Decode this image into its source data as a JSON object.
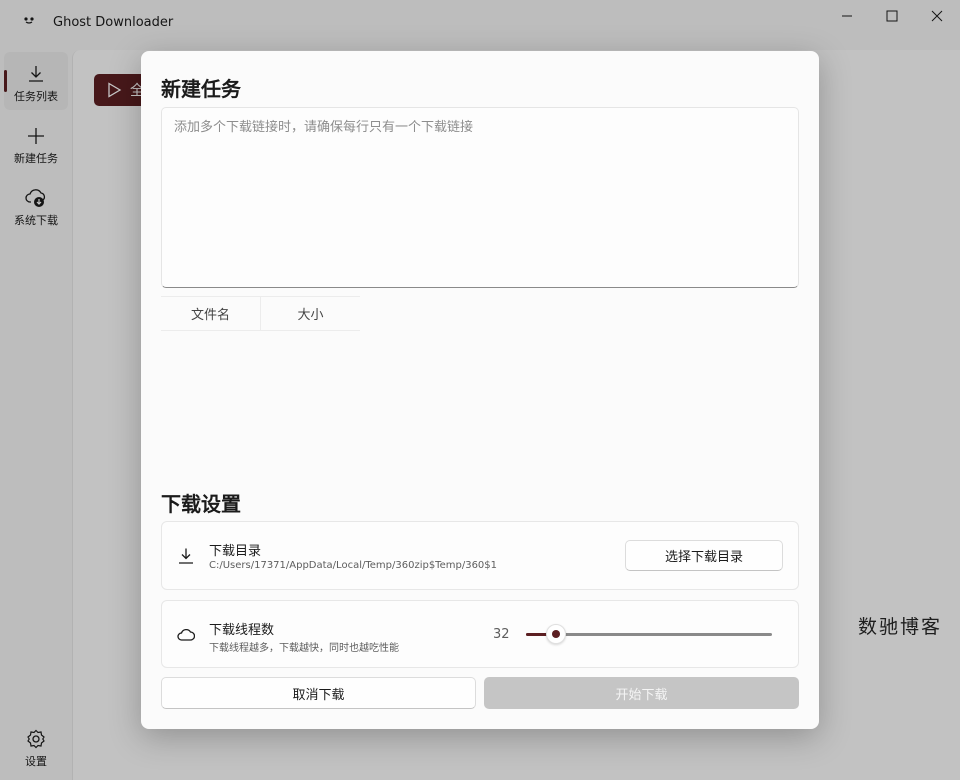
{
  "window": {
    "title": "Ghost Downloader",
    "controls": [
      "minimize-icon",
      "maximize-icon",
      "close-icon"
    ]
  },
  "sidebar": {
    "items": [
      {
        "label": "任务列表",
        "icon": "download-icon",
        "active": true
      },
      {
        "label": "新建任务",
        "icon": "plus-icon",
        "active": false
      },
      {
        "label": "系统下载",
        "icon": "cloud-download-icon",
        "active": false
      }
    ],
    "settings_label": "设置"
  },
  "main": {
    "start_all_label": "全"
  },
  "watermark": "数驰博客",
  "dialog": {
    "title": "新建任务",
    "url_placeholder": "添加多个下载链接时，请确保每行只有一个下载链接",
    "url_value": "",
    "table_headers": [
      "文件名",
      "大小"
    ],
    "settings_title": "下载设置",
    "directory": {
      "title": "下载目录",
      "path": "C:/Users/17371/AppData/Local/Temp/360zip$Temp/360$1",
      "button_label": "选择下载目录"
    },
    "threads": {
      "title": "下载线程数",
      "description": "下载线程越多，下载越快，同时也越吃性能",
      "value": "32",
      "fraction": 0.12
    },
    "cancel_label": "取消下载",
    "start_label": "开始下载"
  },
  "colors": {
    "accent": "#5c1f22",
    "disabled": "#c5c5c5"
  }
}
